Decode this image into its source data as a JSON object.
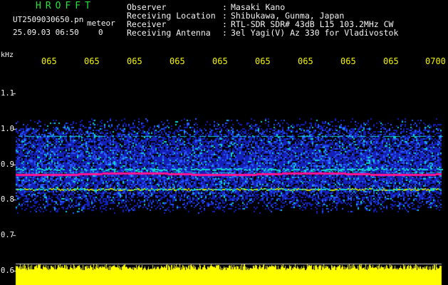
{
  "header": {
    "app_name": "HROFFT",
    "file_name": "UT2509030650.pn",
    "mode_label": "meteor",
    "date_time": "25.09.03 06:50",
    "extra_value": "0"
  },
  "info": [
    {
      "label": "Observer",
      "value": "Masaki Kano"
    },
    {
      "label": "Receiving Location",
      "value": "Shibukawa, Gunma, Japan"
    },
    {
      "label": "Receiver",
      "value": "RTL-SDR SDR# 43dB L15 103.2MHz CW"
    },
    {
      "label": "Receiving Antenna",
      "value": "3el Yagi(V) Az 330 for Vladivostok"
    }
  ],
  "axis": {
    "unit_label": "kHz",
    "time_labels": [
      "065",
      "065",
      "065",
      "065",
      "065",
      "065",
      "065",
      "065",
      "065",
      "0700"
    ],
    "freq_labels": [
      "1.1",
      "1.0",
      "0.9",
      "0.8",
      "0.7",
      "0.6"
    ]
  },
  "colors": {
    "background": "#000000",
    "band_low": "#1420b8",
    "band_mid": "#12d4d4",
    "carrier": "#ff1493",
    "noise_floor": "#ffff00",
    "axis_text": "#ffff00"
  }
}
